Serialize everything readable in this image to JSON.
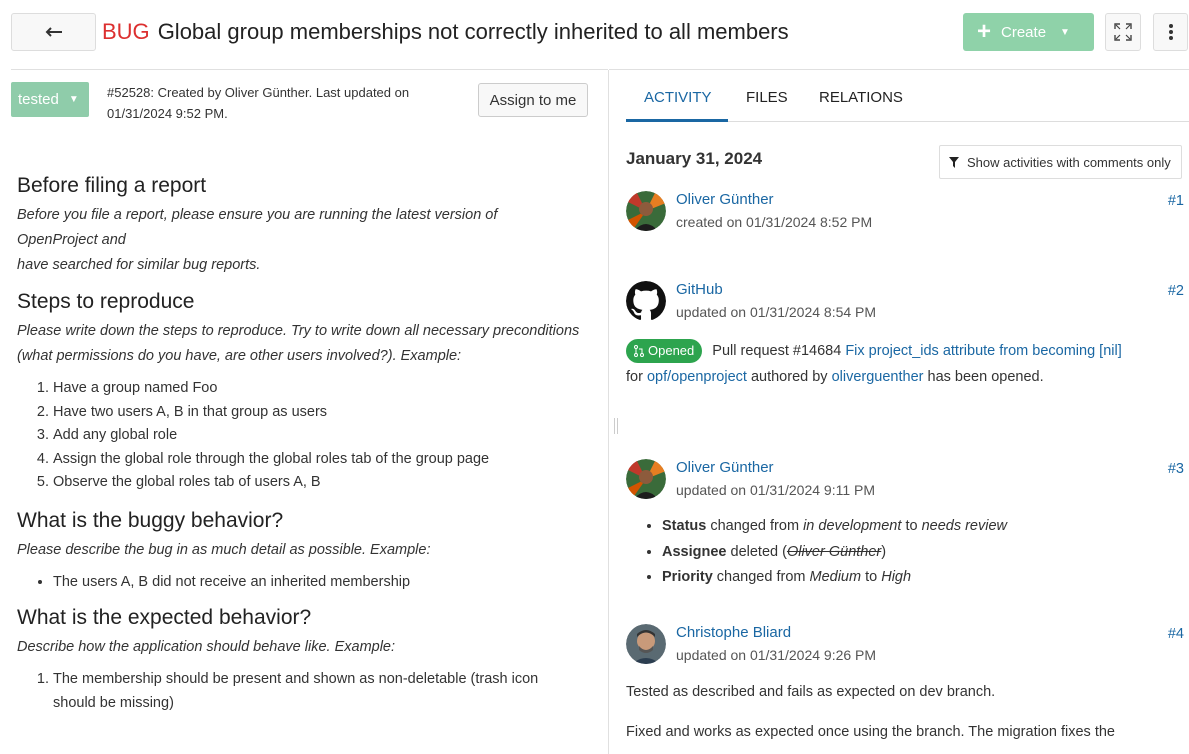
{
  "header": {
    "type_label": "BUG",
    "title": "Global group memberships not correctly inherited to all members",
    "create_label": "Create"
  },
  "left": {
    "status": "tested",
    "meta": "#52528: Created by Oliver Günther. Last updated on 01/31/2024 9:52 PM.",
    "assign_label": "Assign to me",
    "sections": {
      "s1": {
        "heading": "Before filing a report",
        "text1": "Before you file a report, please ensure you are running the latest version of OpenProject and",
        "text2": "have searched for similar bug reports."
      },
      "s2": {
        "heading": "Steps to reproduce",
        "text": "Please write down the steps to reproduce. Try to write down all necessary preconditions (what permissions do you have, are other users involved?). Example:",
        "steps": [
          "Have a group named Foo",
          "Have two users A, B in that group as users",
          "Add any global role",
          "Assign the global role through the global roles tab of the group page",
          "Observe the global roles tab of users A, B"
        ]
      },
      "s3": {
        "heading": "What is the buggy behavior?",
        "text": "Please describe the bug in as much detail as possible. Example:",
        "items": [
          "The users A, B did not receive an inherited membership"
        ]
      },
      "s4": {
        "heading": "What is the expected behavior?",
        "text": "Describe how the application should behave like. Example:",
        "items": [
          "The membership should be present and shown as non-deletable (trash icon should be missing)"
        ]
      }
    }
  },
  "right": {
    "tabs": [
      "ACTIVITY",
      "FILES",
      "RELATIONS"
    ],
    "date_heading": "January 31, 2024",
    "filter_label": "Show activities with comments only",
    "activities": [
      {
        "user": "Oliver Günther",
        "time": "created on 01/31/2024 8:52 PM",
        "num": "#1"
      },
      {
        "user": "GitHub",
        "time": "updated on 01/31/2024 8:54 PM",
        "num": "#2",
        "badge": "Opened",
        "pr_text": "Pull request #14684",
        "pr_link": "Fix project_ids attribute from becoming [nil]",
        "for": "for",
        "repo": "opf/openproject",
        "authored_by": "authored by",
        "author": "oliverguenther",
        "opened": "has been opened."
      },
      {
        "user": "Oliver Günther",
        "time": "updated on 01/31/2024 9:11 PM",
        "num": "#3",
        "changes": [
          {
            "field": "Status",
            "verb": "changed from",
            "from": "in development",
            "to_word": "to",
            "to": "needs review"
          },
          {
            "field": "Assignee",
            "verb": "deleted (",
            "removed": "Oliver Günther",
            "close": ")"
          },
          {
            "field": "Priority",
            "verb": "changed from",
            "from": "Medium",
            "to_word": "to",
            "to": "High"
          }
        ]
      },
      {
        "user": "Christophe Bliard",
        "time": "updated on 01/31/2024 9:26 PM",
        "num": "#4",
        "comment1": "Tested as described and fails as expected on dev branch.",
        "comment2": "Fixed and works as expected once using the branch. The migration fixes the"
      }
    ]
  },
  "colors": {
    "accent": "#1a67a3",
    "bug": "#dc2f2f",
    "create": "#8fd2a9",
    "status_tested": "#8fccaa",
    "opened_badge": "#2da44e"
  },
  "icons": [
    "back-arrow-icon",
    "plus-icon",
    "caret-down-icon",
    "fullscreen-icon",
    "more-vertical-icon",
    "filter-icon",
    "github-icon",
    "pull-request-icon"
  ]
}
